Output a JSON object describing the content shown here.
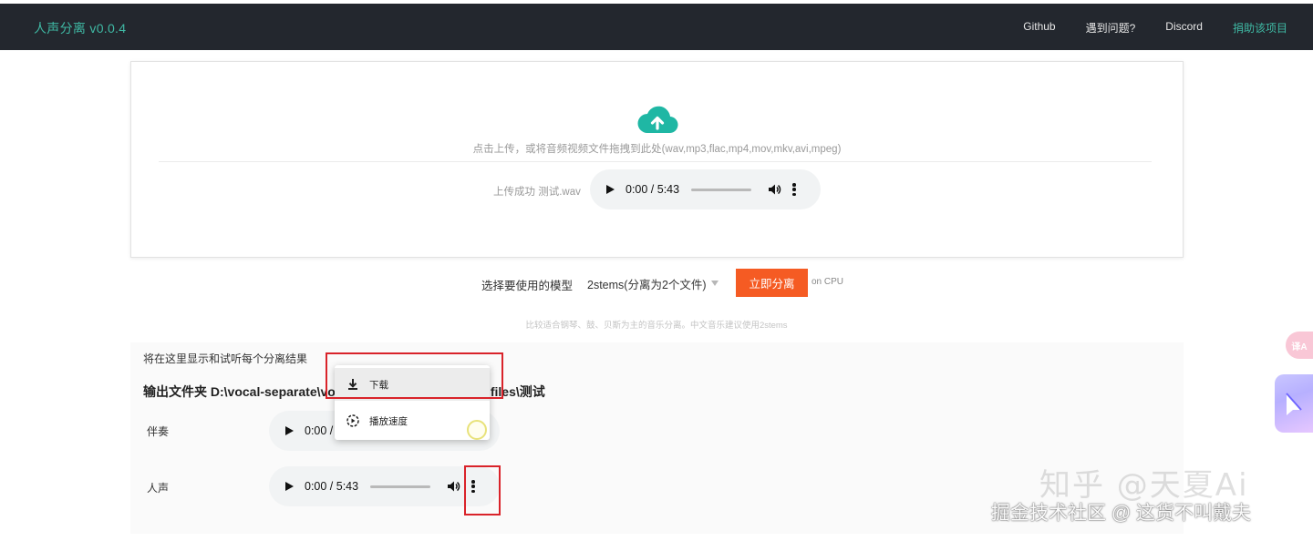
{
  "header": {
    "brand": "人声分离 v0.0.4",
    "links": [
      "Github",
      "遇到问题?",
      "Discord",
      "捐助该项目"
    ],
    "accent_color": "#3fb9a4",
    "bg_color": "#23272e"
  },
  "upload": {
    "icon": "cloud-upload-icon",
    "hint": "点击上传，或将音频视频文件拖拽到此处(wav,mp3,flac,mp4,mov,mkv,avi,mpeg)",
    "status": "上传成功 测试.wav",
    "player_time": "0:00 / 5:43"
  },
  "model": {
    "label": "选择要使用的模型",
    "selected": "2stems(分离为2个文件)",
    "button": "立即分离",
    "device": "on CPU",
    "hint": "比较适合钢琴、鼓、贝斯为主的音乐分离。中文音乐建议使用2stems",
    "button_color": "#f55b23"
  },
  "results": {
    "intro": "将在这里显示和试听每个分离结果",
    "output_path": "输出文件夹 D:\\vocal-separate\\vo",
    "output_path_tail": "files\\测试",
    "tracks": [
      {
        "label": "伴奏",
        "time": "0:00 /"
      },
      {
        "label": "人声",
        "time": "0:00 / 5:43"
      }
    ]
  },
  "context_menu": {
    "items": [
      "下载",
      "播放速度"
    ]
  },
  "side_widgets": {
    "translate": "译A"
  },
  "watermarks": {
    "zhihu": "知乎 @天夏Ai",
    "juejin": "掘金技术社区 @ 这货不叫戴夫"
  }
}
